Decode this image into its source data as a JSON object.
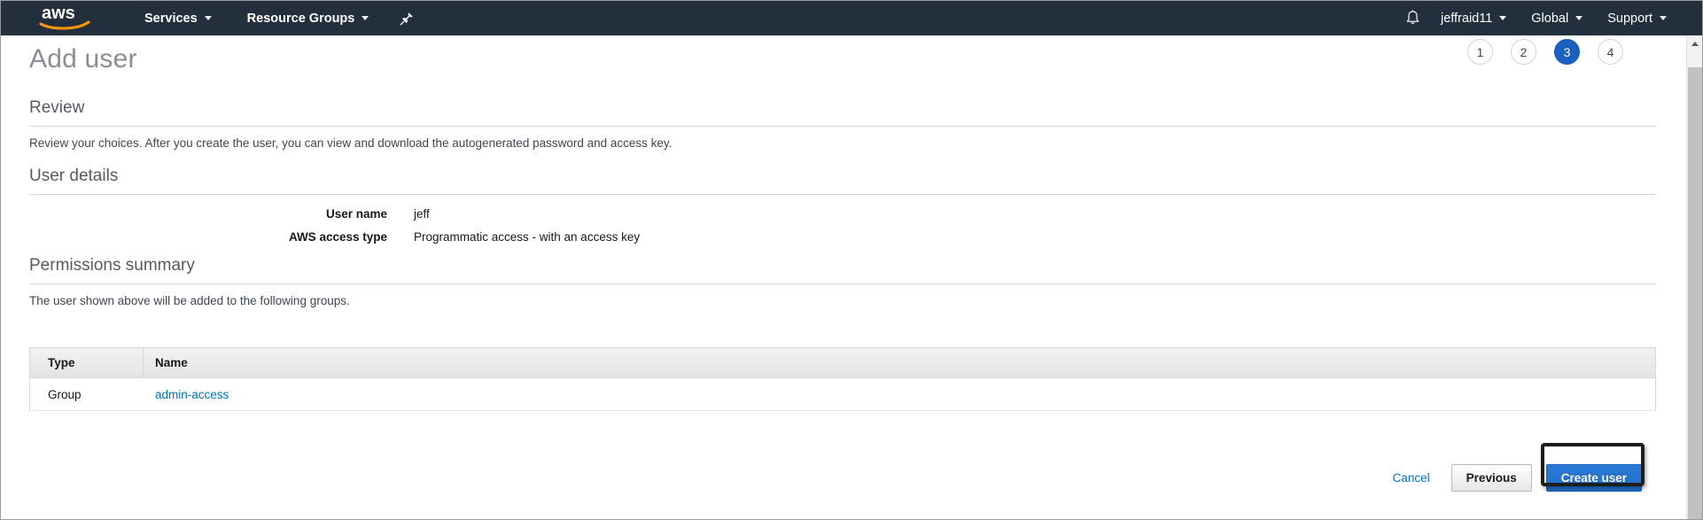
{
  "nav": {
    "logo_alt": "aws",
    "services_label": "Services",
    "resource_groups_label": "Resource Groups",
    "pin_icon": "pin-icon",
    "bell_icon": "bell-icon",
    "account_label": "jeffraid11",
    "region_label": "Global",
    "support_label": "Support"
  },
  "page": {
    "title": "Add user",
    "steps": [
      {
        "number": "1",
        "active": false
      },
      {
        "number": "2",
        "active": false
      },
      {
        "number": "3",
        "active": true
      },
      {
        "number": "4",
        "active": false
      }
    ]
  },
  "review": {
    "heading": "Review",
    "description": "Review your choices. After you create the user, you can view and download the autogenerated password and access key."
  },
  "user_details": {
    "heading": "User details",
    "rows": [
      {
        "label": "User name",
        "value": "jeff"
      },
      {
        "label": "AWS access type",
        "value": "Programmatic access - with an access key"
      }
    ]
  },
  "permissions_summary": {
    "heading": "Permissions summary",
    "description": "The user shown above will be added to the following groups.",
    "table": {
      "columns": [
        "Type",
        "Name"
      ],
      "rows": [
        {
          "type": "Group",
          "name": "admin-access"
        }
      ]
    }
  },
  "footer": {
    "cancel_label": "Cancel",
    "previous_label": "Previous",
    "create_label": "Create user"
  },
  "colors": {
    "nav_background": "#242f3e",
    "accent_blue": "#1e6ec8",
    "link_blue": "#0073bb",
    "step_active": "#1a5fbd",
    "logo_orange": "#ff9900",
    "annotation": "#1d1d1d"
  }
}
